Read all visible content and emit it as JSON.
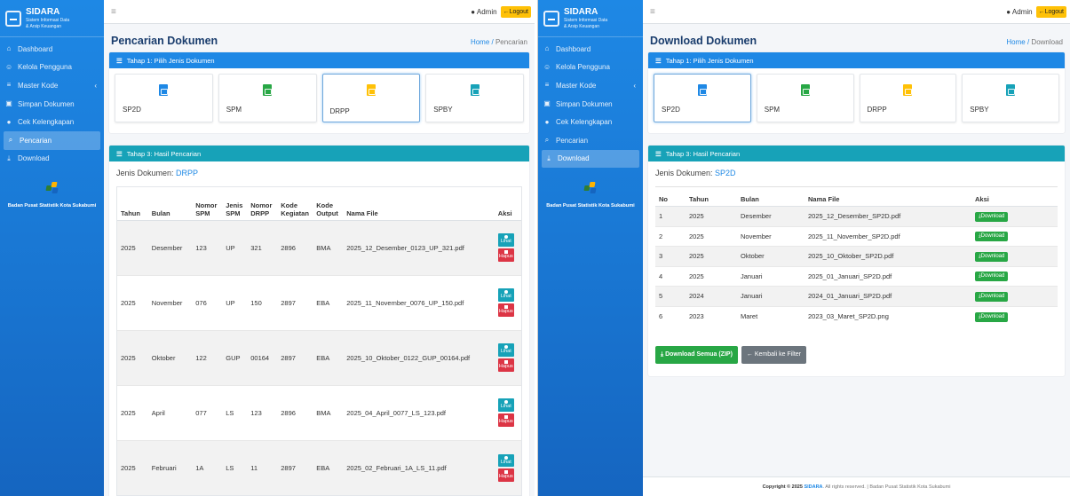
{
  "app": {
    "title": "SIDARA",
    "subtitle1": "Sistem Informasi Data",
    "subtitle2": "& Arsip Keuangan",
    "org_name": "Badan Pusat Statistik Kota Sukabumi"
  },
  "nav": [
    {
      "label": "Dashboard",
      "icon": "home-icon"
    },
    {
      "label": "Kelola Pengguna",
      "icon": "users-icon"
    },
    {
      "label": "Master Kode",
      "icon": "list-icon"
    },
    {
      "label": "Simpan Dokumen",
      "icon": "save-icon"
    },
    {
      "label": "Cek Kelengkapan",
      "icon": "check-circle-icon"
    },
    {
      "label": "Pencarian",
      "icon": "search-icon"
    },
    {
      "label": "Download",
      "icon": "download-icon"
    }
  ],
  "topbar": {
    "menu_glyph": "≡",
    "admin_label": "Admin",
    "logout_label": "Logout"
  },
  "doc_types": [
    "SP2D",
    "SPM",
    "DRPP",
    "SPBY"
  ],
  "colors": {
    "sp2d": "#1e88e5",
    "spm": "#28a745",
    "drpp": "#ffc107",
    "spby": "#17a2b8"
  },
  "left": {
    "page_title": "Pencarian Dokumen",
    "breadcrumb_home": "Home",
    "breadcrumb_current": "Pencarian",
    "step1": "Tahap 1: Pilih Jenis Dokumen",
    "step3": "Tahap 3: Hasil Pencarian",
    "jenis_label": "Jenis Dokumen:",
    "jenis_value": "DRPP",
    "columns": [
      "Tahun",
      "Bulan",
      "Nomor SPM",
      "Jenis SPM",
      "Nomor DRPP",
      "Kode Kegiatan",
      "Kode Output",
      "Nama File",
      "Aksi"
    ],
    "rows": [
      [
        "2025",
        "Desember",
        "123",
        "UP",
        "321",
        "2896",
        "BMA",
        "2025_12_Desember_0123_UP_321.pdf"
      ],
      [
        "2025",
        "November",
        "076",
        "UP",
        "150",
        "2897",
        "EBA",
        "2025_11_November_0076_UP_150.pdf"
      ],
      [
        "2025",
        "Oktober",
        "122",
        "GUP",
        "00164",
        "2897",
        "EBA",
        "2025_10_Oktober_0122_GUP_00164.pdf"
      ],
      [
        "2025",
        "April",
        "077",
        "LS",
        "123",
        "2896",
        "BMA",
        "2025_04_April_0077_LS_123.pdf"
      ],
      [
        "2025",
        "Februari",
        "1A",
        "LS",
        "11",
        "2897",
        "EBA",
        "2025_02_Februari_1A_LS_11.pdf"
      ]
    ],
    "view_label": "Lihat",
    "delete_label": "Hapus"
  },
  "right": {
    "page_title": "Download Dokumen",
    "breadcrumb_home": "Home",
    "breadcrumb_current": "Download",
    "step1": "Tahap 1: Pilih Jenis Dokumen",
    "step3": "Tahap 3: Hasil Pencarian",
    "jenis_label": "Jenis Dokumen:",
    "jenis_value": "SP2D",
    "columns": [
      "No",
      "Tahun",
      "Bulan",
      "Nama File",
      "Aksi"
    ],
    "rows": [
      [
        "1",
        "2025",
        "Desember",
        "2025_12_Desember_SP2D.pdf"
      ],
      [
        "2",
        "2025",
        "November",
        "2025_11_November_SP2D.pdf"
      ],
      [
        "3",
        "2025",
        "Oktober",
        "2025_10_Oktober_SP2D.pdf"
      ],
      [
        "4",
        "2025",
        "Januari",
        "2025_01_Januari_SP2D.pdf"
      ],
      [
        "5",
        "2024",
        "Januari",
        "2024_01_Januari_SP2D.pdf"
      ],
      [
        "6",
        "2023",
        "Maret",
        "2023_03_Maret_SP2D.png"
      ]
    ],
    "download_label": "Download",
    "download_all_label": "Download Semua (ZIP)",
    "back_label": "Kembali ke Filter",
    "footer_prefix": "Copyright © 2025",
    "footer_brand": "SIDARA",
    "footer_suffix": ". All rights reserved. | Badan Pusat Statistik Kota Sukabumi"
  }
}
